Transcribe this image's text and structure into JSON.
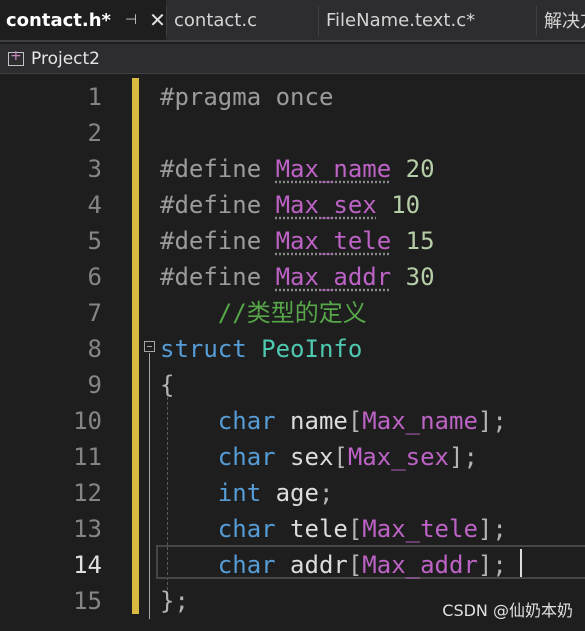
{
  "tabs": [
    {
      "label": "contact.h*",
      "active": true,
      "pinned": true
    },
    {
      "label": "contact.c",
      "active": false
    },
    {
      "label": "FileName.text.c*",
      "active": false
    },
    {
      "label": "解决方",
      "active": false
    }
  ],
  "tab_icons": {
    "pin": "pin-icon",
    "close": "close-icon"
  },
  "project": {
    "name": "Project2",
    "icon": "project-icon"
  },
  "editor": {
    "current_line": 14,
    "line_numbers": [
      "1",
      "2",
      "3",
      "4",
      "5",
      "6",
      "7",
      "8",
      "9",
      "10",
      "11",
      "12",
      "13",
      "14",
      "15"
    ],
    "lines": [
      [
        {
          "t": "#pragma once",
          "c": "pp"
        }
      ],
      [],
      [
        {
          "t": "#define ",
          "c": "pp"
        },
        {
          "t": "Max_name",
          "c": "macro"
        },
        {
          "t": " 20",
          "c": "num"
        }
      ],
      [
        {
          "t": "#define ",
          "c": "pp"
        },
        {
          "t": "Max_sex",
          "c": "macro"
        },
        {
          "t": " 10",
          "c": "num"
        }
      ],
      [
        {
          "t": "#define ",
          "c": "pp"
        },
        {
          "t": "Max_tele",
          "c": "macro"
        },
        {
          "t": " 15",
          "c": "num"
        }
      ],
      [
        {
          "t": "#define ",
          "c": "pp"
        },
        {
          "t": "Max_addr",
          "c": "macro"
        },
        {
          "t": " 30",
          "c": "num"
        }
      ],
      [
        {
          "t": "    //类型的定义",
          "c": "comment"
        }
      ],
      [
        {
          "t": "struct",
          "c": "kw"
        },
        {
          "t": " ",
          "c": "plain"
        },
        {
          "t": "PeoInfo",
          "c": "type"
        }
      ],
      [
        {
          "t": "{",
          "c": "punct"
        }
      ],
      [
        {
          "t": "    ",
          "c": "plain"
        },
        {
          "t": "char",
          "c": "kw"
        },
        {
          "t": " name",
          "c": "plain"
        },
        {
          "t": "[",
          "c": "punct"
        },
        {
          "t": "Max_name",
          "c": "mref"
        },
        {
          "t": "];",
          "c": "punct"
        }
      ],
      [
        {
          "t": "    ",
          "c": "plain"
        },
        {
          "t": "char",
          "c": "kw"
        },
        {
          "t": " sex",
          "c": "plain"
        },
        {
          "t": "[",
          "c": "punct"
        },
        {
          "t": "Max_sex",
          "c": "mref"
        },
        {
          "t": "];",
          "c": "punct"
        }
      ],
      [
        {
          "t": "    ",
          "c": "plain"
        },
        {
          "t": "int",
          "c": "kw"
        },
        {
          "t": " age",
          "c": "plain"
        },
        {
          "t": ";",
          "c": "punct"
        }
      ],
      [
        {
          "t": "    ",
          "c": "plain"
        },
        {
          "t": "char",
          "c": "kw"
        },
        {
          "t": " tele",
          "c": "plain"
        },
        {
          "t": "[",
          "c": "punct"
        },
        {
          "t": "Max_tele",
          "c": "mref"
        },
        {
          "t": "];",
          "c": "punct"
        }
      ],
      [
        {
          "t": "    ",
          "c": "plain"
        },
        {
          "t": "char",
          "c": "kw"
        },
        {
          "t": " addr",
          "c": "plain"
        },
        {
          "t": "[",
          "c": "punct"
        },
        {
          "t": "Max_addr",
          "c": "mref"
        },
        {
          "t": "];",
          "c": "punct"
        }
      ],
      [
        {
          "t": "};",
          "c": "punct"
        }
      ]
    ]
  },
  "watermark": "CSDN @仙奶本奶"
}
